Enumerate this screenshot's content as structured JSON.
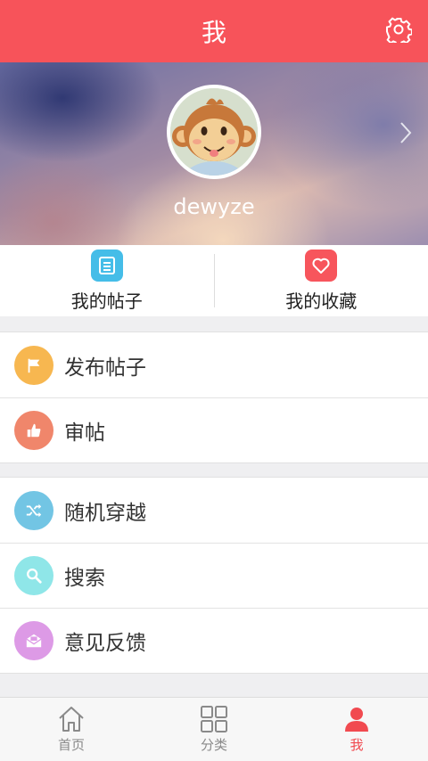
{
  "header": {
    "title": "我"
  },
  "profile": {
    "username": "dewyze"
  },
  "quick": {
    "posts_label": "我的帖子",
    "favorites_label": "我的收藏"
  },
  "menu_group1": [
    {
      "label": "发布帖子",
      "icon": "flag-icon",
      "color": "#f7b750"
    },
    {
      "label": "审帖",
      "icon": "thumbs-up-icon",
      "color": "#f0866b"
    }
  ],
  "menu_group2": [
    {
      "label": "随机穿越",
      "icon": "shuffle-icon",
      "color": "#72c5e4"
    },
    {
      "label": "搜索",
      "icon": "search-icon",
      "color": "#8fe6e8"
    },
    {
      "label": "意见反馈",
      "icon": "mail-icon",
      "color": "#dd9ae6"
    }
  ],
  "tabs": [
    {
      "label": "首页",
      "icon": "home-icon",
      "active": false
    },
    {
      "label": "分类",
      "icon": "grid-icon",
      "active": false
    },
    {
      "label": "我",
      "icon": "user-icon",
      "active": true
    }
  ],
  "colors": {
    "accent": "#f7535a",
    "active_tab": "#f14a50",
    "posts_icon_bg": "#45bde8",
    "fav_icon_bg": "#f7555c"
  }
}
